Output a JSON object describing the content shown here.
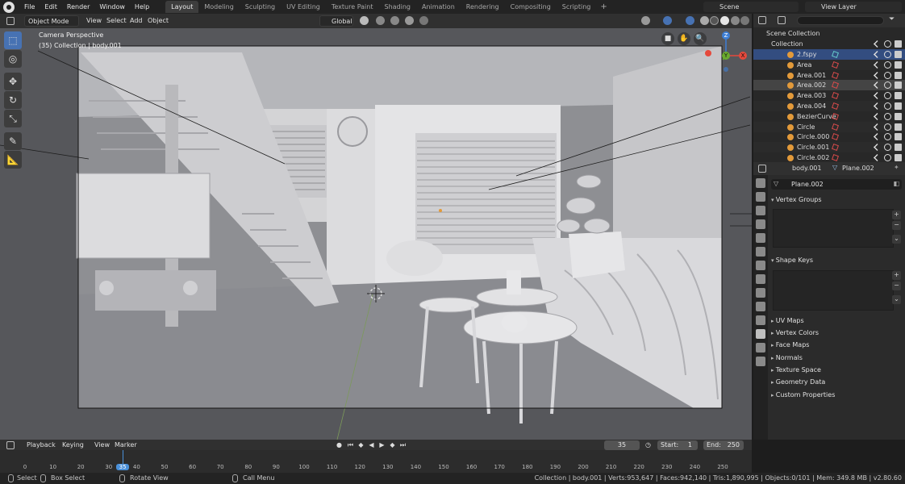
{
  "top_menu": [
    "File",
    "Edit",
    "Render",
    "Window",
    "Help"
  ],
  "workspaces": [
    "Layout",
    "Modeling",
    "Sculpting",
    "UV Editing",
    "Texture Paint",
    "Shading",
    "Animation",
    "Rendering",
    "Compositing",
    "Scripting"
  ],
  "workspace_add": "+",
  "scene_name": "Scene",
  "view_layer": "View Layer",
  "viewport_header": {
    "mode": "Object Mode",
    "menus": [
      "View",
      "Select",
      "Add",
      "Object"
    ],
    "orientation": "Global"
  },
  "viewport": {
    "overlay_line1": "Camera Perspective",
    "overlay_line2": "(35) Collection | body.001",
    "axis_x": "X",
    "axis_y": "Y",
    "axis_z": "Z"
  },
  "toolbar_icons": [
    "select-box-icon",
    "cursor-icon",
    "move-icon",
    "rotate-icon",
    "scale-icon",
    "annotate-icon",
    "measure-icon"
  ],
  "outliner": {
    "search_placeholder": "",
    "root": "Scene Collection",
    "collection": "Collection",
    "items": [
      {
        "name": "2.fspy",
        "state": "selected"
      },
      {
        "name": "Area",
        "state": ""
      },
      {
        "name": "Area.001",
        "state": ""
      },
      {
        "name": "Area.002",
        "state": "highlight"
      },
      {
        "name": "Area.003",
        "state": ""
      },
      {
        "name": "Area.004",
        "state": ""
      },
      {
        "name": "BezierCurve",
        "state": ""
      },
      {
        "name": "Circle",
        "state": ""
      },
      {
        "name": "Circle.000",
        "state": ""
      },
      {
        "name": "Circle.001",
        "state": ""
      },
      {
        "name": "Circle.002",
        "state": ""
      }
    ]
  },
  "properties": {
    "object_name": "body.001",
    "mesh_name": "Plane.002",
    "data_field": "Plane.002",
    "vertex_groups": "Vertex Groups",
    "shape_keys": "Shape Keys",
    "collapsed_panels": [
      "UV Maps",
      "Vertex Colors",
      "Face Maps",
      "Normals",
      "Texture Space",
      "Geometry Data",
      "Custom Properties"
    ]
  },
  "timeline": {
    "menus": [
      "Playback",
      "Keying",
      "View",
      "Marker"
    ],
    "current_frame": "35",
    "start_label": "Start:",
    "start": "1",
    "end_label": "End:",
    "end": "250",
    "ruler_ticks": [
      "0",
      "10",
      "20",
      "30",
      "35",
      "40",
      "50",
      "60",
      "70",
      "80",
      "90",
      "100",
      "110",
      "120",
      "130",
      "140",
      "150",
      "160",
      "170",
      "180",
      "190",
      "200",
      "210",
      "220",
      "230",
      "240",
      "250"
    ]
  },
  "status_bar": {
    "select": "Select",
    "box_select": "Box Select",
    "rotate_view": "Rotate View",
    "call_menu": "Call Menu",
    "stats": "Collection | body.001 | Verts:953,647 | Faces:942,140 | Tris:1,890,995 | Objects:0/101 | Mem: 349.8 MB | v2.80.60"
  },
  "colors": {
    "accent": "#4772b3",
    "selected_row": "#334d80",
    "axis_x": "#e5493c",
    "axis_y": "#6aab2e",
    "axis_z": "#3d7fd6",
    "playhead": "#4a90d9"
  }
}
